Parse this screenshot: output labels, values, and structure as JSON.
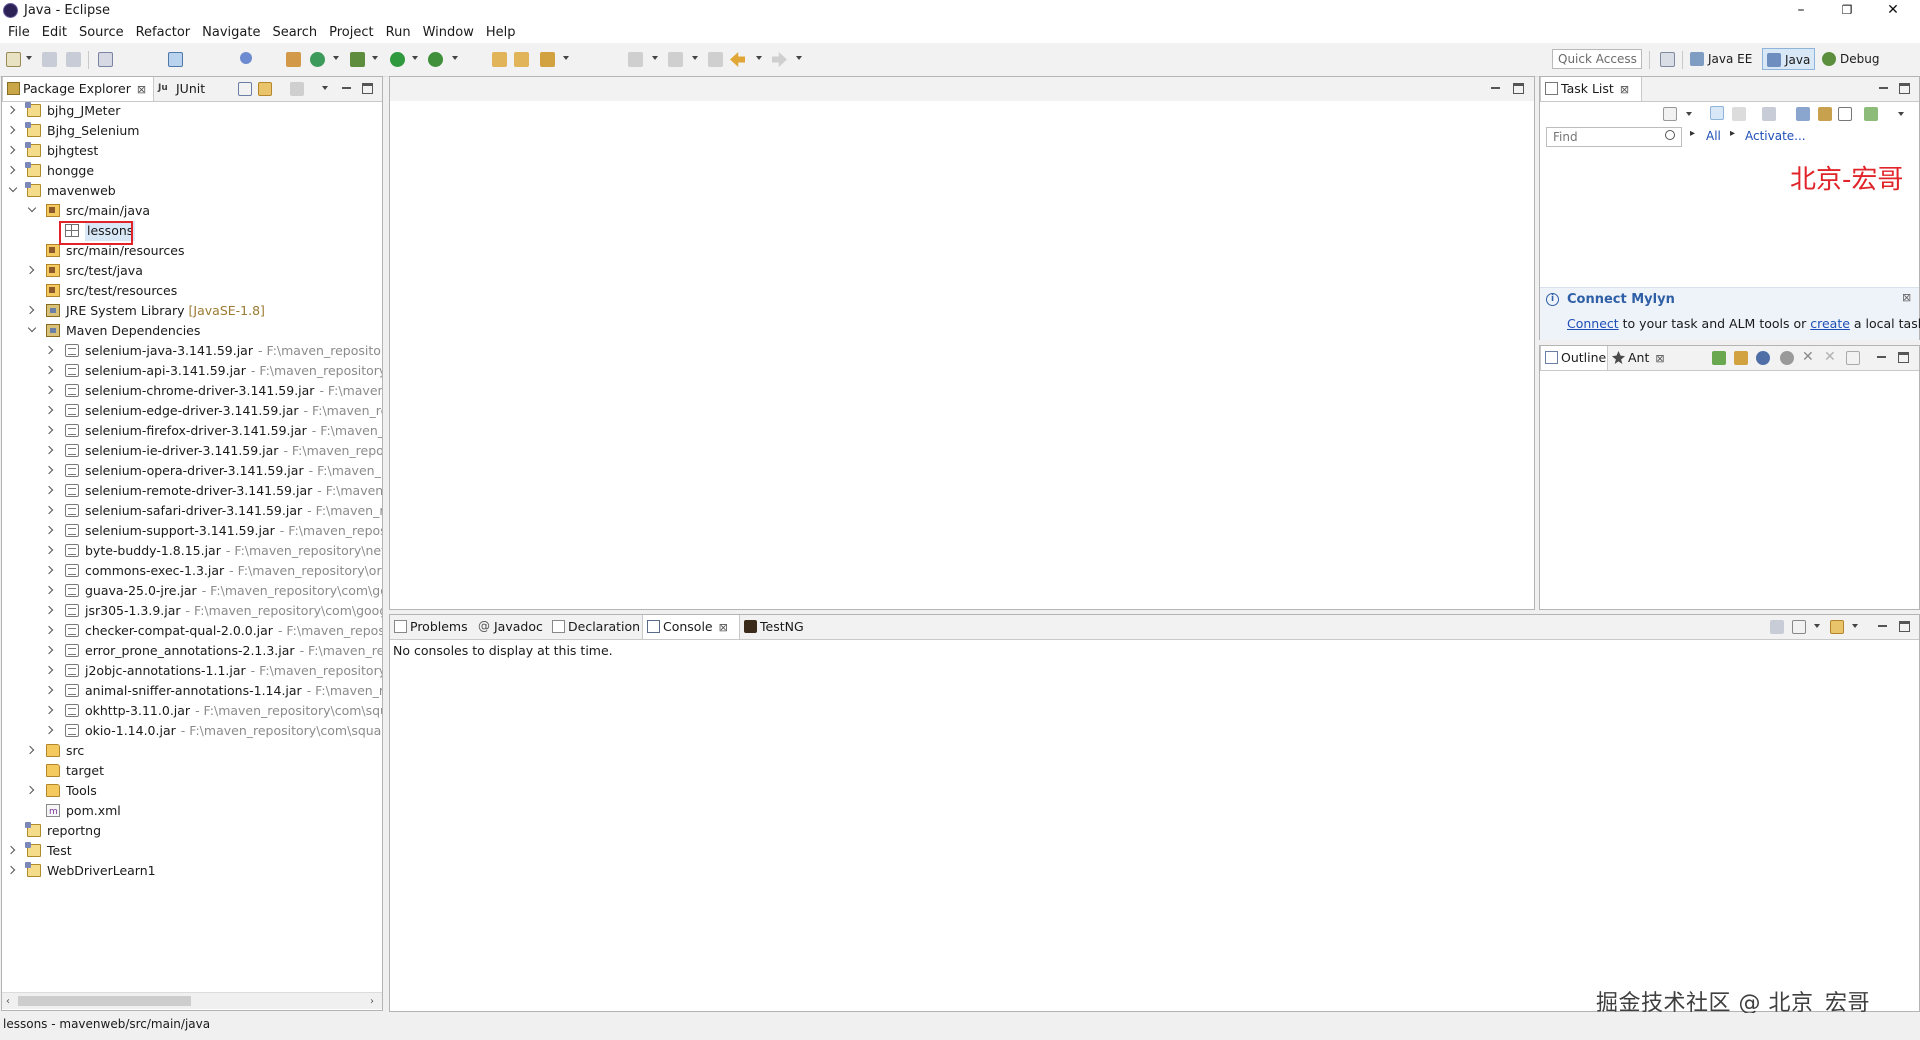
{
  "window": {
    "title": "Java - Eclipse",
    "minimize": "–",
    "restore": "❐",
    "close": "✕"
  },
  "menu": [
    "File",
    "Edit",
    "Source",
    "Refactor",
    "Navigate",
    "Search",
    "Project",
    "Run",
    "Window",
    "Help"
  ],
  "toolbar": {
    "quick_access": "Quick Access",
    "perspectives": [
      {
        "label": "Java EE",
        "active": false
      },
      {
        "label": "Java",
        "active": true
      },
      {
        "label": "Debug",
        "active": false
      }
    ]
  },
  "package_explorer": {
    "tabs": [
      "Package Explorer",
      "JUnit"
    ],
    "close_glyph": "⊠",
    "unit_badge": "Ju",
    "tree": [
      {
        "level": 0,
        "expander": "closed",
        "icon": "project",
        "label": "bjhg_JMeter"
      },
      {
        "level": 0,
        "expander": "closed",
        "icon": "project",
        "label": "Bjhg_Selenium"
      },
      {
        "level": 0,
        "expander": "closed",
        "icon": "project",
        "label": "bjhgtest"
      },
      {
        "level": 0,
        "expander": "closed",
        "icon": "project",
        "label": "hongge"
      },
      {
        "level": 0,
        "expander": "open",
        "icon": "project",
        "label": "mavenweb"
      },
      {
        "level": 1,
        "expander": "open",
        "icon": "srcfolder",
        "label": "src/main/java"
      },
      {
        "level": 2,
        "expander": "none",
        "icon": "pkg",
        "label": "lessons",
        "highlight": true
      },
      {
        "level": 1,
        "expander": "none",
        "icon": "srcfolder",
        "label": "src/main/resources"
      },
      {
        "level": 1,
        "expander": "closed",
        "icon": "srcfolder",
        "label": "src/test/java"
      },
      {
        "level": 1,
        "expander": "none",
        "icon": "srcfolder",
        "label": "src/test/resources"
      },
      {
        "level": 1,
        "expander": "closed",
        "icon": "lib",
        "label": "JRE System Library",
        "deco": "[JavaSE-1.8]"
      },
      {
        "level": 1,
        "expander": "open",
        "icon": "lib",
        "label": "Maven Dependencies"
      },
      {
        "level": 2,
        "expander": "closed",
        "icon": "jar",
        "label": "selenium-java-3.141.59.jar",
        "path": "- F:\\maven_repository\\or"
      },
      {
        "level": 2,
        "expander": "closed",
        "icon": "jar",
        "label": "selenium-api-3.141.59.jar",
        "path": "- F:\\maven_repository\\org"
      },
      {
        "level": 2,
        "expander": "closed",
        "icon": "jar",
        "label": "selenium-chrome-driver-3.141.59.jar",
        "path": "- F:\\maven_rep"
      },
      {
        "level": 2,
        "expander": "closed",
        "icon": "jar",
        "label": "selenium-edge-driver-3.141.59.jar",
        "path": "- F:\\maven_repos"
      },
      {
        "level": 2,
        "expander": "closed",
        "icon": "jar",
        "label": "selenium-firefox-driver-3.141.59.jar",
        "path": "- F:\\maven_repc"
      },
      {
        "level": 2,
        "expander": "closed",
        "icon": "jar",
        "label": "selenium-ie-driver-3.141.59.jar",
        "path": "- F:\\maven_repositor"
      },
      {
        "level": 2,
        "expander": "closed",
        "icon": "jar",
        "label": "selenium-opera-driver-3.141.59.jar",
        "path": "- F:\\maven_repo"
      },
      {
        "level": 2,
        "expander": "closed",
        "icon": "jar",
        "label": "selenium-remote-driver-3.141.59.jar",
        "path": "- F:\\maven_rep"
      },
      {
        "level": 2,
        "expander": "closed",
        "icon": "jar",
        "label": "selenium-safari-driver-3.141.59.jar",
        "path": "- F:\\maven_repo:"
      },
      {
        "level": 2,
        "expander": "closed",
        "icon": "jar",
        "label": "selenium-support-3.141.59.jar",
        "path": "- F:\\maven_repositor"
      },
      {
        "level": 2,
        "expander": "closed",
        "icon": "jar",
        "label": "byte-buddy-1.8.15.jar",
        "path": "- F:\\maven_repository\\net\\byt"
      },
      {
        "level": 2,
        "expander": "closed",
        "icon": "jar",
        "label": "commons-exec-1.3.jar",
        "path": "- F:\\maven_repository\\org\\a|"
      },
      {
        "level": 2,
        "expander": "closed",
        "icon": "jar",
        "label": "guava-25.0-jre.jar",
        "path": "- F:\\maven_repository\\com\\goog"
      },
      {
        "level": 2,
        "expander": "closed",
        "icon": "jar",
        "label": "jsr305-1.3.9.jar",
        "path": "- F:\\maven_repository\\com\\google\\"
      },
      {
        "level": 2,
        "expander": "closed",
        "icon": "jar",
        "label": "checker-compat-qual-2.0.0.jar",
        "path": "- F:\\maven_repositor"
      },
      {
        "level": 2,
        "expander": "closed",
        "icon": "jar",
        "label": "error_prone_annotations-2.1.3.jar",
        "path": "- F:\\maven_repos"
      },
      {
        "level": 2,
        "expander": "closed",
        "icon": "jar",
        "label": "j2objc-annotations-1.1.jar",
        "path": "- F:\\maven_repository\\co"
      },
      {
        "level": 2,
        "expander": "closed",
        "icon": "jar",
        "label": "animal-sniffer-annotations-1.14.jar",
        "path": "- F:\\maven_repo"
      },
      {
        "level": 2,
        "expander": "closed",
        "icon": "jar",
        "label": "okhttp-3.11.0.jar",
        "path": "- F:\\maven_repository\\com\\square"
      },
      {
        "level": 2,
        "expander": "closed",
        "icon": "jar",
        "label": "okio-1.14.0.jar",
        "path": "- F:\\maven_repository\\com\\squareu|"
      },
      {
        "level": 1,
        "expander": "closed",
        "icon": "folder",
        "label": "src"
      },
      {
        "level": 1,
        "expander": "none",
        "icon": "folder",
        "label": "target"
      },
      {
        "level": 1,
        "expander": "closed",
        "icon": "folder",
        "label": "Tools"
      },
      {
        "level": 1,
        "expander": "none",
        "icon": "xml",
        "label": "pom.xml"
      },
      {
        "level": 0,
        "expander": "none",
        "icon": "project",
        "label": "reportng"
      },
      {
        "level": 0,
        "expander": "closed",
        "icon": "project",
        "label": "Test"
      },
      {
        "level": 0,
        "expander": "closed",
        "icon": "project",
        "label": "WebDriverLearn1"
      }
    ]
  },
  "task_list": {
    "tab": "Task List",
    "find_placeholder": "Find",
    "filter_all": "All",
    "filter_activate": "Activate...",
    "watermark_red": "北京-宏哥",
    "connect_title": "Connect Mylyn",
    "connect_link": "Connect",
    "connect_mid": " to your task and ALM tools or ",
    "create_link": "create",
    "connect_end": " a local task."
  },
  "outline": {
    "tabs": [
      "Outline",
      "Ant"
    ]
  },
  "console": {
    "tabs": [
      "Problems",
      "Javadoc",
      "Declaration",
      "Console",
      "TestNG"
    ],
    "selected": "Console",
    "message": "No consoles to display at this time."
  },
  "watermark": "掘金技术社区 @ 北京_宏哥",
  "status": "lessons - mavenweb/src/main/java",
  "colors": {
    "selection_frame": "#e0242a",
    "link": "#1f4fb6",
    "watermark_red": "#e0242a"
  }
}
